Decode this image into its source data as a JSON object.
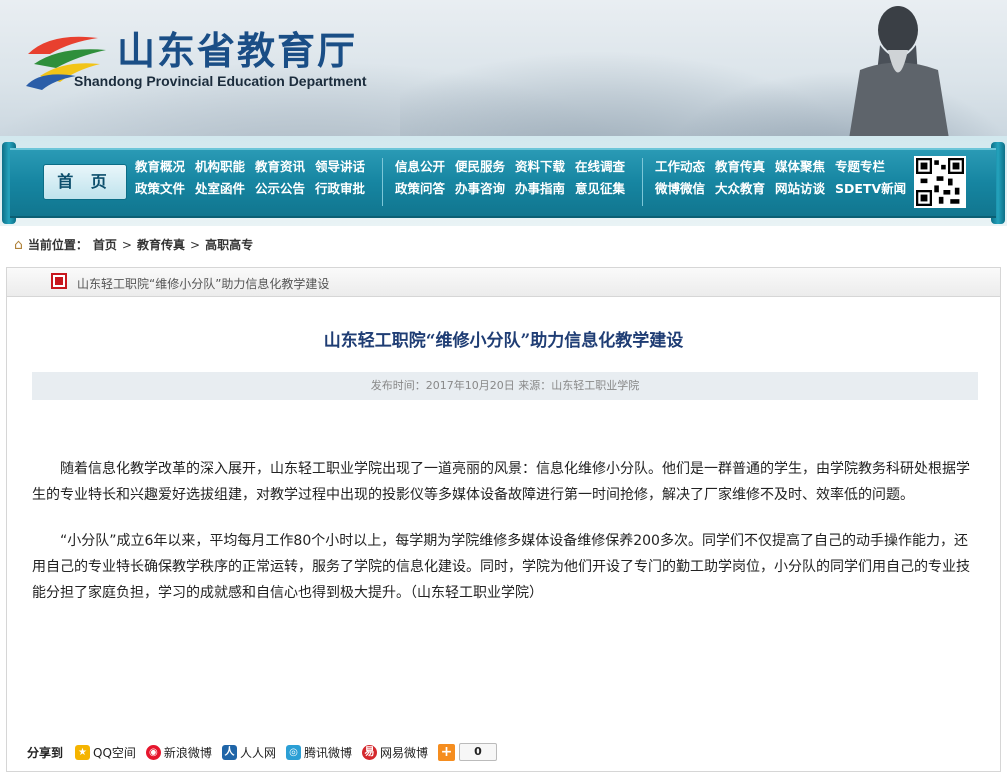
{
  "header": {
    "site_title_cn": "山东省教育厅",
    "site_title_en": "Shandong Provincial Education Department"
  },
  "nav": {
    "home_label": "首 页",
    "group1": [
      "教育概况",
      "机构职能",
      "教育资讯",
      "领导讲话",
      "政策文件",
      "处室函件",
      "公示公告",
      "行政审批"
    ],
    "group2": [
      "信息公开",
      "便民服务",
      "资料下载",
      "在线调查",
      "政策问答",
      "办事咨询",
      "办事指南",
      "意见征集"
    ],
    "group3": [
      "工作动态",
      "教育传真",
      "媒体聚焦",
      "专题专栏",
      "微博微信",
      "大众教育",
      "网站访谈",
      "SDETV新闻"
    ]
  },
  "breadcrumb": {
    "label": "当前位置：",
    "items": [
      "首页",
      "教育传真",
      "高职高专"
    ],
    "separator": ">"
  },
  "article": {
    "header_title": "山东轻工职院“维修小分队”助力信息化教学建设",
    "title": "山东轻工职院“维修小分队”助力信息化教学建设",
    "meta": "发布时间：2017年10月20日  来源：山东轻工职业学院",
    "paragraphs": [
      "随着信息化教学改革的深入展开，山东轻工职业学院出现了一道亮丽的风景：信息化维修小分队。他们是一群普通的学生，由学院教务科研处根据学生的专业特长和兴趣爱好选拔组建，对教学过程中出现的投影仪等多媒体设备故障进行第一时间抢修，解决了厂家维修不及时、效率低的问题。",
      "“小分队”成立6年以来，平均每月工作80个小时以上，每学期为学院维修多媒体设备维修保养200多次。同学们不仅提高了自己的动手操作能力，还用自己的专业特长确保教学秩序的正常运转，服务了学院的信息化建设。同时，学院为他们开设了专门的勤工助学岗位，小分队的同学们用自己的专业技能分担了家庭负担，学习的成就感和自信心也得到极大提升。（山东轻工职业学院）"
    ]
  },
  "share": {
    "label": "分享到",
    "items": [
      {
        "label": "QQ空间",
        "icon": "qzone-icon",
        "color": "#f5b400"
      },
      {
        "label": "新浪微博",
        "icon": "weibo-icon",
        "color": "#e6162d"
      },
      {
        "label": "人人网",
        "icon": "renren-icon",
        "color": "#1f65a8"
      },
      {
        "label": "腾讯微博",
        "icon": "tencent-weibo-icon",
        "color": "#2b9fd5"
      },
      {
        "label": "网易微博",
        "icon": "netease-weibo-icon",
        "color": "#d4282d"
      }
    ],
    "more_icon": "+",
    "count": "0"
  }
}
